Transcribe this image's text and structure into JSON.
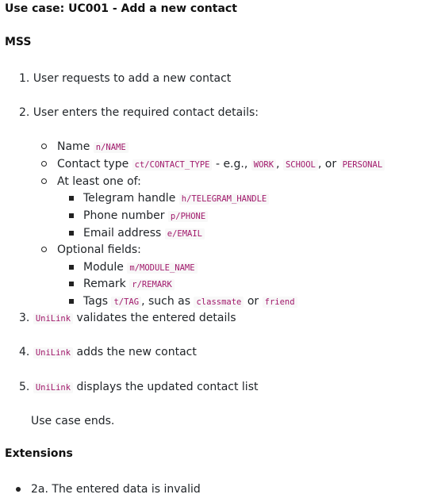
{
  "title": "Use case: UC001 - Add a new contact",
  "mss_heading": "MSS",
  "steps": [
    {
      "num": "1.",
      "text": "User requests to add a new contact"
    },
    {
      "num": "2.",
      "text": "User enters the required contact details:"
    },
    {
      "num": "3.",
      "code": "UniLink",
      "text": "validates the entered details"
    },
    {
      "num": "4.",
      "code": "UniLink",
      "text": "adds the new contact"
    },
    {
      "num": "5.",
      "code": "UniLink",
      "text": "displays the updated contact list"
    }
  ],
  "details": {
    "name": {
      "label": "Name",
      "code": "n/NAME"
    },
    "contact_type": {
      "label": "Contact type",
      "code": "ct/CONTACT_TYPE",
      "eg": "- e.g.,",
      "opt1": "WORK",
      "sep1": ",",
      "opt2": "SCHOOL",
      "sep2": ", or",
      "opt3": "PERSONAL"
    },
    "at_least": {
      "label": "At least one of:"
    },
    "telegram": {
      "label": "Telegram handle",
      "code": "h/TELEGRAM_HANDLE"
    },
    "phone": {
      "label": "Phone number",
      "code": "p/PHONE"
    },
    "email": {
      "label": "Email address",
      "code": "e/EMAIL"
    },
    "optional": {
      "label": "Optional fields:"
    },
    "module": {
      "label": "Module",
      "code": "m/MODULE_NAME"
    },
    "remark": {
      "label": "Remark",
      "code": "r/REMARK"
    },
    "tags": {
      "label": "Tags",
      "code": "t/TAG",
      "suffix": ", such as",
      "ex1": "classmate",
      "or": "or",
      "ex2": "friend"
    }
  },
  "use_case_ends": "Use case ends.",
  "extensions_heading": "Extensions",
  "extensions": [
    {
      "text": "2a. The entered data is invalid"
    }
  ]
}
